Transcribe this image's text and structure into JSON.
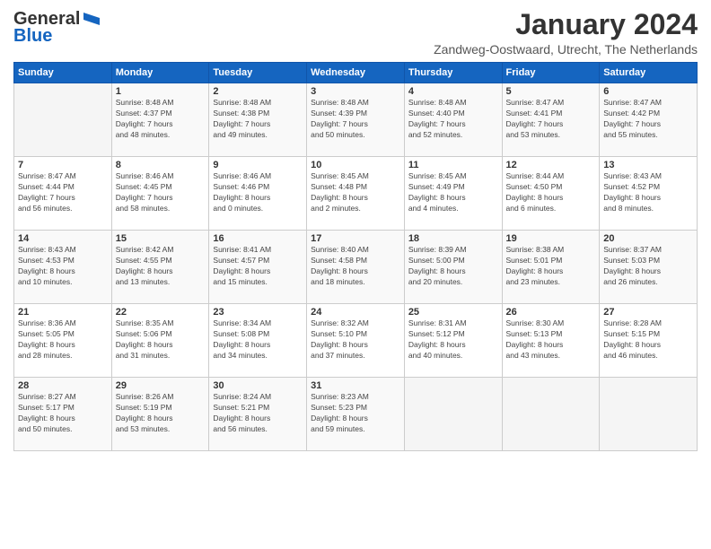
{
  "logo": {
    "general": "General",
    "blue": "Blue",
    "icon": "▶"
  },
  "header": {
    "month_title": "January 2024",
    "location": "Zandweg-Oostwaard, Utrecht, The Netherlands"
  },
  "days_of_week": [
    "Sunday",
    "Monday",
    "Tuesday",
    "Wednesday",
    "Thursday",
    "Friday",
    "Saturday"
  ],
  "weeks": [
    [
      {
        "day": "",
        "info": ""
      },
      {
        "day": "1",
        "info": "Sunrise: 8:48 AM\nSunset: 4:37 PM\nDaylight: 7 hours\nand 48 minutes."
      },
      {
        "day": "2",
        "info": "Sunrise: 8:48 AM\nSunset: 4:38 PM\nDaylight: 7 hours\nand 49 minutes."
      },
      {
        "day": "3",
        "info": "Sunrise: 8:48 AM\nSunset: 4:39 PM\nDaylight: 7 hours\nand 50 minutes."
      },
      {
        "day": "4",
        "info": "Sunrise: 8:48 AM\nSunset: 4:40 PM\nDaylight: 7 hours\nand 52 minutes."
      },
      {
        "day": "5",
        "info": "Sunrise: 8:47 AM\nSunset: 4:41 PM\nDaylight: 7 hours\nand 53 minutes."
      },
      {
        "day": "6",
        "info": "Sunrise: 8:47 AM\nSunset: 4:42 PM\nDaylight: 7 hours\nand 55 minutes."
      }
    ],
    [
      {
        "day": "7",
        "info": "Sunrise: 8:47 AM\nSunset: 4:44 PM\nDaylight: 7 hours\nand 56 minutes."
      },
      {
        "day": "8",
        "info": "Sunrise: 8:46 AM\nSunset: 4:45 PM\nDaylight: 7 hours\nand 58 minutes."
      },
      {
        "day": "9",
        "info": "Sunrise: 8:46 AM\nSunset: 4:46 PM\nDaylight: 8 hours\nand 0 minutes."
      },
      {
        "day": "10",
        "info": "Sunrise: 8:45 AM\nSunset: 4:48 PM\nDaylight: 8 hours\nand 2 minutes."
      },
      {
        "day": "11",
        "info": "Sunrise: 8:45 AM\nSunset: 4:49 PM\nDaylight: 8 hours\nand 4 minutes."
      },
      {
        "day": "12",
        "info": "Sunrise: 8:44 AM\nSunset: 4:50 PM\nDaylight: 8 hours\nand 6 minutes."
      },
      {
        "day": "13",
        "info": "Sunrise: 8:43 AM\nSunset: 4:52 PM\nDaylight: 8 hours\nand 8 minutes."
      }
    ],
    [
      {
        "day": "14",
        "info": "Sunrise: 8:43 AM\nSunset: 4:53 PM\nDaylight: 8 hours\nand 10 minutes."
      },
      {
        "day": "15",
        "info": "Sunrise: 8:42 AM\nSunset: 4:55 PM\nDaylight: 8 hours\nand 13 minutes."
      },
      {
        "day": "16",
        "info": "Sunrise: 8:41 AM\nSunset: 4:57 PM\nDaylight: 8 hours\nand 15 minutes."
      },
      {
        "day": "17",
        "info": "Sunrise: 8:40 AM\nSunset: 4:58 PM\nDaylight: 8 hours\nand 18 minutes."
      },
      {
        "day": "18",
        "info": "Sunrise: 8:39 AM\nSunset: 5:00 PM\nDaylight: 8 hours\nand 20 minutes."
      },
      {
        "day": "19",
        "info": "Sunrise: 8:38 AM\nSunset: 5:01 PM\nDaylight: 8 hours\nand 23 minutes."
      },
      {
        "day": "20",
        "info": "Sunrise: 8:37 AM\nSunset: 5:03 PM\nDaylight: 8 hours\nand 26 minutes."
      }
    ],
    [
      {
        "day": "21",
        "info": "Sunrise: 8:36 AM\nSunset: 5:05 PM\nDaylight: 8 hours\nand 28 minutes."
      },
      {
        "day": "22",
        "info": "Sunrise: 8:35 AM\nSunset: 5:06 PM\nDaylight: 8 hours\nand 31 minutes."
      },
      {
        "day": "23",
        "info": "Sunrise: 8:34 AM\nSunset: 5:08 PM\nDaylight: 8 hours\nand 34 minutes."
      },
      {
        "day": "24",
        "info": "Sunrise: 8:32 AM\nSunset: 5:10 PM\nDaylight: 8 hours\nand 37 minutes."
      },
      {
        "day": "25",
        "info": "Sunrise: 8:31 AM\nSunset: 5:12 PM\nDaylight: 8 hours\nand 40 minutes."
      },
      {
        "day": "26",
        "info": "Sunrise: 8:30 AM\nSunset: 5:13 PM\nDaylight: 8 hours\nand 43 minutes."
      },
      {
        "day": "27",
        "info": "Sunrise: 8:28 AM\nSunset: 5:15 PM\nDaylight: 8 hours\nand 46 minutes."
      }
    ],
    [
      {
        "day": "28",
        "info": "Sunrise: 8:27 AM\nSunset: 5:17 PM\nDaylight: 8 hours\nand 50 minutes."
      },
      {
        "day": "29",
        "info": "Sunrise: 8:26 AM\nSunset: 5:19 PM\nDaylight: 8 hours\nand 53 minutes."
      },
      {
        "day": "30",
        "info": "Sunrise: 8:24 AM\nSunset: 5:21 PM\nDaylight: 8 hours\nand 56 minutes."
      },
      {
        "day": "31",
        "info": "Sunrise: 8:23 AM\nSunset: 5:23 PM\nDaylight: 8 hours\nand 59 minutes."
      },
      {
        "day": "",
        "info": ""
      },
      {
        "day": "",
        "info": ""
      },
      {
        "day": "",
        "info": ""
      }
    ]
  ]
}
